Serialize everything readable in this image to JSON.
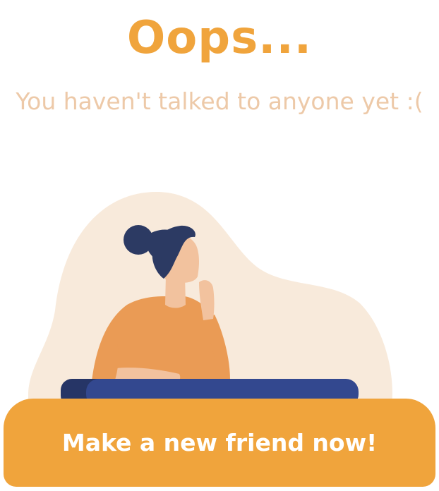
{
  "empty_state": {
    "title": "Oops...",
    "subtitle": "You haven't talked to anyone yet :("
  },
  "illustration": {
    "icon": "woman-thinking-at-desk-illustration"
  },
  "cta": {
    "label": "Make a new friend now!"
  },
  "colors": {
    "accent": "#F0A43C",
    "subtitle": "#EDC9A8",
    "blob": "#F8EADB",
    "skin": "#F2C29E",
    "shirt": "#EA9B55",
    "hair": "#2C3A63",
    "desk": "#33488F",
    "desk_shadow": "#263566"
  }
}
